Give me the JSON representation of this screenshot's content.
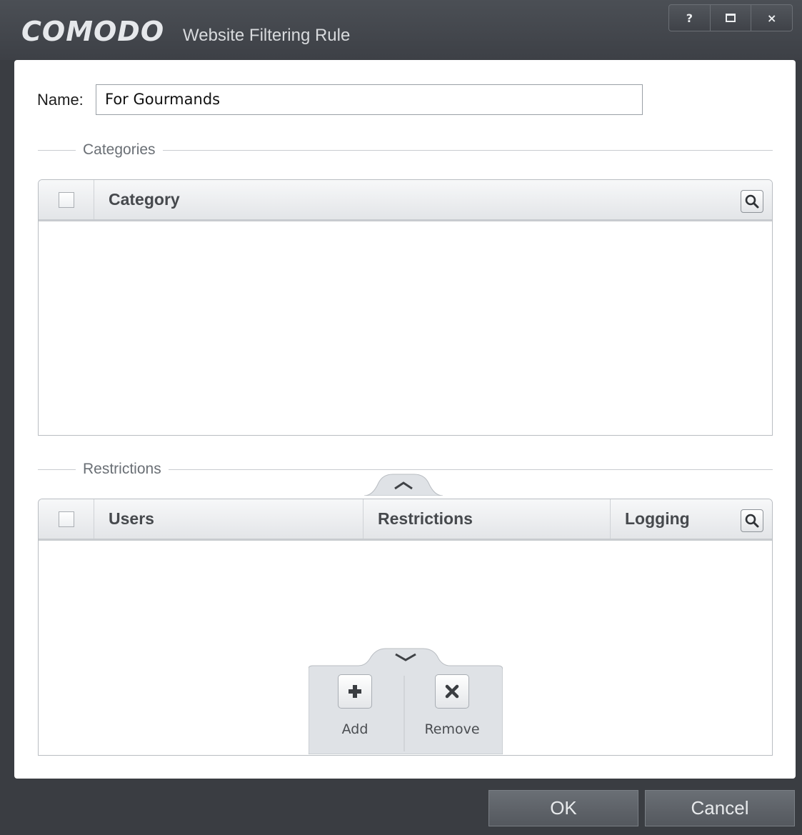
{
  "window": {
    "brand": "COMODO",
    "title": "Website Filtering Rule",
    "help_label": "?",
    "close_label": "×"
  },
  "name_field": {
    "label": "Name:",
    "value": "For Gourmands"
  },
  "categories": {
    "section_label": "Categories",
    "columns": [
      "Category"
    ],
    "rows": []
  },
  "restrictions": {
    "section_label": "Restrictions",
    "columns": [
      "Users",
      "Restrictions",
      "Logging"
    ],
    "rows": []
  },
  "toolbar": {
    "add_label": "Add",
    "remove_label": "Remove"
  },
  "footer": {
    "ok_label": "OK",
    "cancel_label": "Cancel"
  }
}
